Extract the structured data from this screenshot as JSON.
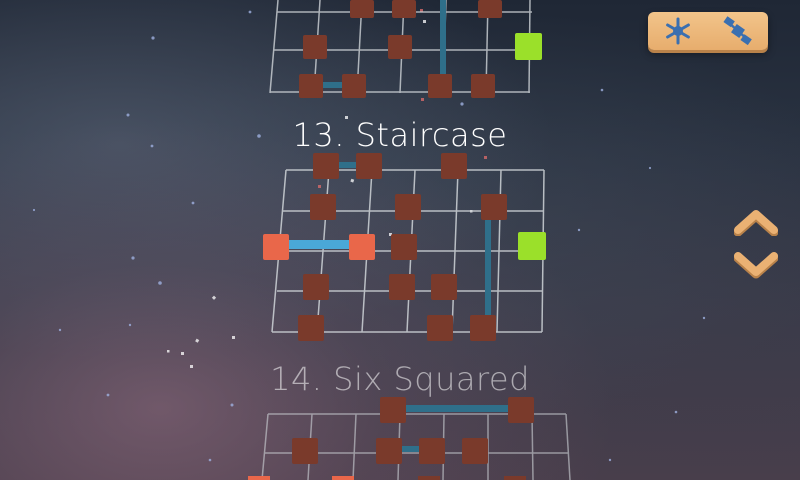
{
  "levels": [
    {
      "number": "13.",
      "name": "Staircase",
      "state": "current"
    },
    {
      "number": "14.",
      "name": "Six Squared",
      "state": "next"
    }
  ],
  "toolbar": {
    "settings_icon": "snowflake-gear-icon",
    "robot_icon": "satellite-icon"
  },
  "navigation": {
    "up_icon": "chevron-up-icon",
    "down_icon": "chevron-down-icon"
  },
  "colors": {
    "block": "#7a3a2b",
    "goal_block": "#9be02a",
    "player_block": "#e9674a",
    "player_link": "#4aa8d8",
    "link": "#2f6f8a",
    "grid": "#cfd4d8",
    "button": "#eab173",
    "arrow": "#eab173"
  }
}
